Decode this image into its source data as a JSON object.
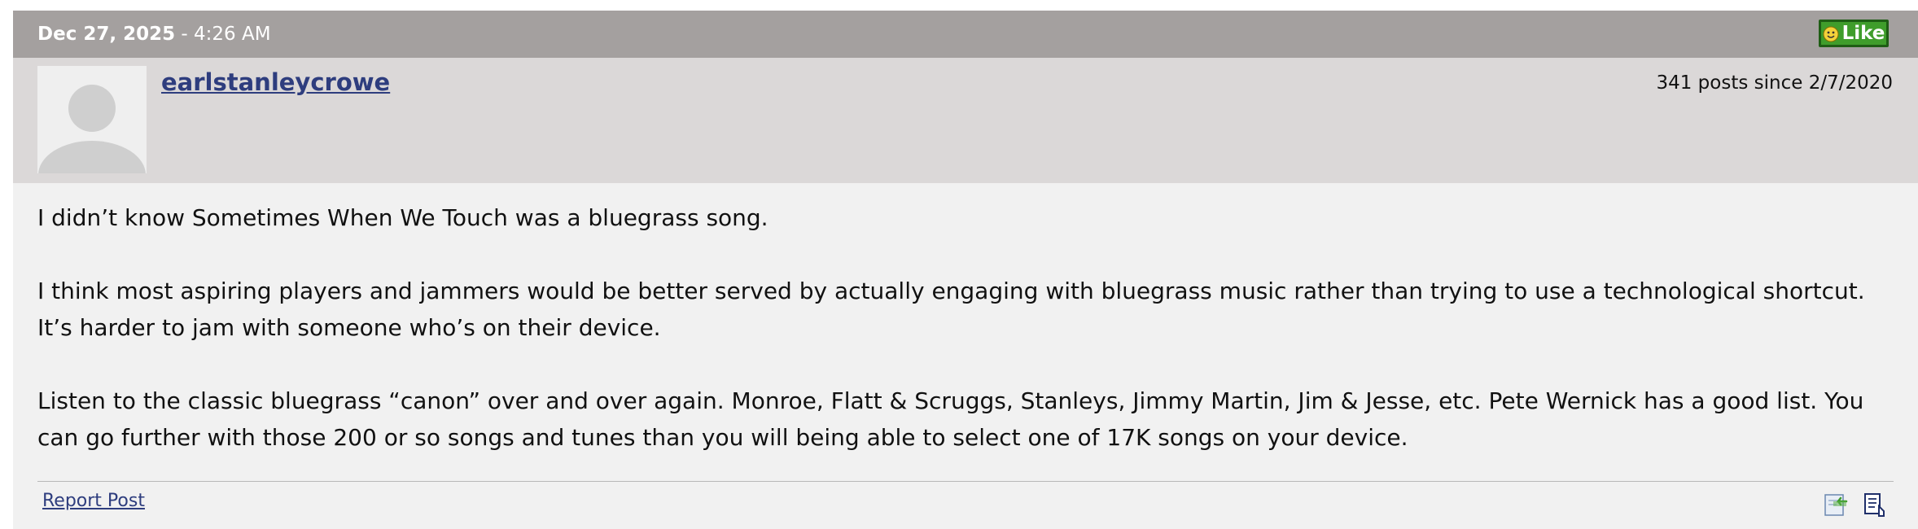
{
  "post": {
    "date": "Dec 27, 2025",
    "time_separator": " - ",
    "time": "4:26 AM",
    "like_label": "Like",
    "author": {
      "username": "earlstanleycrowe",
      "post_count_text": "341 posts since 2/7/2020"
    },
    "paragraphs": [
      "I didn’t know Sometimes When We Touch was a bluegrass song.",
      "I think most aspiring players and jammers would be better served by actually engaging with bluegrass music rather than trying to use a technological shortcut. It’s harder to jam with someone who’s on their device.",
      "Listen to the classic bluegrass “canon” over and over again. Monroe, Flatt & Scruggs, Stanleys, Jimmy Martin, Jim & Jesse, etc. Pete Wernick has a good list. You can go further with those 200 or so songs and tunes than you will being able to select one of 17K songs on your device."
    ],
    "footer": {
      "report_label": "Report Post"
    }
  },
  "icons": {
    "like": "smiley-icon",
    "avatar": "default-avatar",
    "reply": "reply-icon",
    "quote": "quote-icon"
  },
  "colors": {
    "header_bg": "#a4a09f",
    "author_bar_bg": "#dbd8d8",
    "body_bg": "#f1f1f1",
    "link": "#2e3d7e",
    "like_green": "#3f9d2b"
  }
}
